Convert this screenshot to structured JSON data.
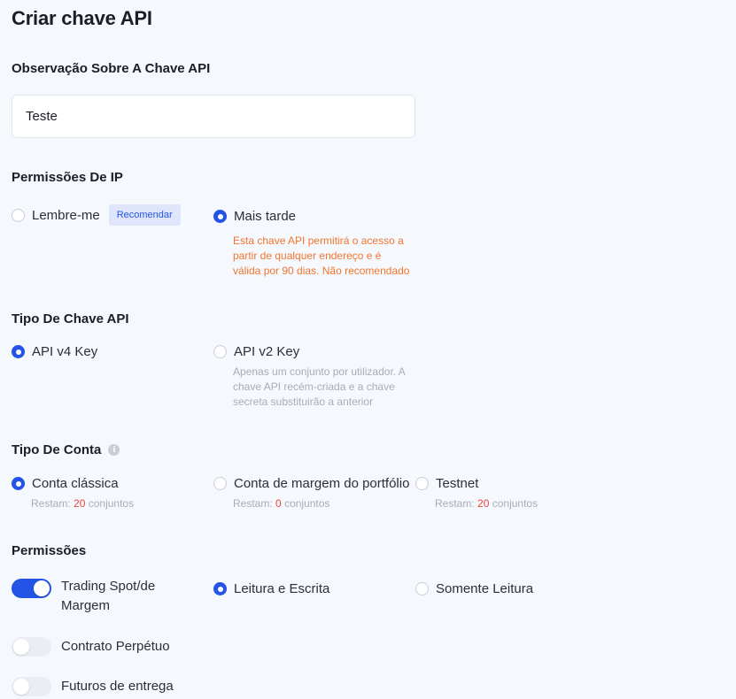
{
  "page": {
    "title": "Criar chave API"
  },
  "note_section": {
    "label": "Observação Sobre A Chave API",
    "value": "Teste"
  },
  "ip_permissions": {
    "label": "Permissões De IP",
    "option_remember": "Lembre-me",
    "badge": "Recomendar",
    "option_later": "Mais tarde",
    "later_note_1": "Esta chave API permitirá o acesso a",
    "later_note_2": "partir de qualquer endereço e é",
    "later_note_3": "válida por 90 dias. Não recomendado",
    "selected": "later"
  },
  "key_type": {
    "label": "Tipo De Chave API",
    "option_v4": "API v4 Key",
    "option_v2": "API v2 Key",
    "v2_note_1": "Apenas um conjunto por utilizador. A",
    "v2_note_2": "chave API recém-criada e a chave",
    "v2_note_3": "secreta substituirão a anterior",
    "selected": "v4"
  },
  "account_type": {
    "label": "Tipo De Conta",
    "info_icon": "i",
    "options": [
      {
        "label": "Conta clássica",
        "remain_prefix": "Restam:",
        "remain_count": "20",
        "remain_suffix": "conjuntos"
      },
      {
        "label": "Conta de margem do portfólio",
        "remain_prefix": "Restam:",
        "remain_count": "0",
        "remain_suffix": "conjuntos"
      },
      {
        "label": "Testnet",
        "remain_prefix": "Restam:",
        "remain_count": "20",
        "remain_suffix": "conjuntos"
      }
    ],
    "selected_index": 0
  },
  "permissions": {
    "label": "Permissões",
    "spot_line_1": "Trading Spot/de",
    "spot_line_2": "Margem",
    "option_read_write": "Leitura e Escrita",
    "option_read_only": "Somente Leitura",
    "perpetual": "Contrato Perpétuo",
    "delivery": "Futuros de entrega",
    "spot_enabled": true,
    "perpetual_enabled": false,
    "delivery_enabled": false
  },
  "colors": {
    "accent": "#2354e6",
    "warning": "#f2762e",
    "danger": "#e8453c"
  }
}
